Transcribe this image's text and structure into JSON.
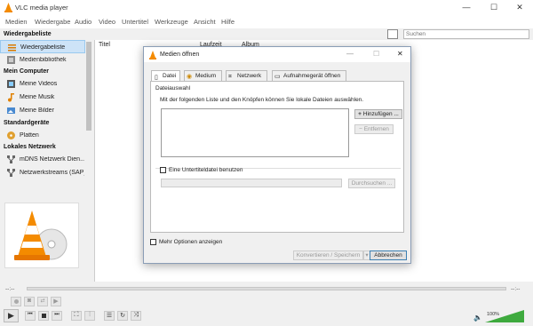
{
  "window": {
    "title": "VLC media player",
    "minimize": "—",
    "maximize": "☐",
    "close": "✕"
  },
  "menu": [
    "Medien",
    "Wiedergabe",
    "Audio",
    "Video",
    "Untertitel",
    "Werkzeuge",
    "Ansicht",
    "Hilfe"
  ],
  "search": {
    "placeholder": "Suchen"
  },
  "sidebar": {
    "headers": [
      "Wiedergabeliste",
      "Mein Computer",
      "Standardgeräte",
      "Lokales Netzwerk"
    ],
    "items": [
      {
        "label": "Wiedergabeliste",
        "icon": "playlist-icon"
      },
      {
        "label": "Medienbibliothek",
        "icon": "library-icon"
      },
      {
        "label": "Meine Videos",
        "icon": "film-icon"
      },
      {
        "label": "Meine Musik",
        "icon": "music-note-icon"
      },
      {
        "label": "Meine Bilder",
        "icon": "picture-icon"
      },
      {
        "label": "Platten",
        "icon": "disc-icon"
      },
      {
        "label": "mDNS Netzwerk Dien...",
        "icon": "network-icon"
      },
      {
        "label": "Netzwerkstreams (SAP)",
        "icon": "network-icon"
      }
    ]
  },
  "playlist": {
    "columns": [
      "Titel",
      "Laufzeit",
      "Album"
    ]
  },
  "dialog": {
    "title": "Medien öffnen",
    "tabs": [
      "Datei",
      "Medium",
      "Netzwerk",
      "Aufnahmegerät öffnen"
    ],
    "group_label": "Dateiauswahl",
    "description": "Mit der folgenden Liste und den Knöpfen können Sie lokale Dateien auswählen.",
    "add_button": "Hinzufügen ...",
    "remove_button": "Entfernen",
    "subtitle_check": "Eine Untertiteldatei benutzen",
    "browse_button": "Durchsuchen ...",
    "more_options": "Mehr Optionen anzeigen",
    "convert_button": "Konvertieren / Speichern",
    "cancel_button": "Abbrechen"
  },
  "seek": {
    "elapsed": "--:--",
    "total": "--:--"
  },
  "volume": {
    "label": "100%",
    "level": 1.0
  }
}
